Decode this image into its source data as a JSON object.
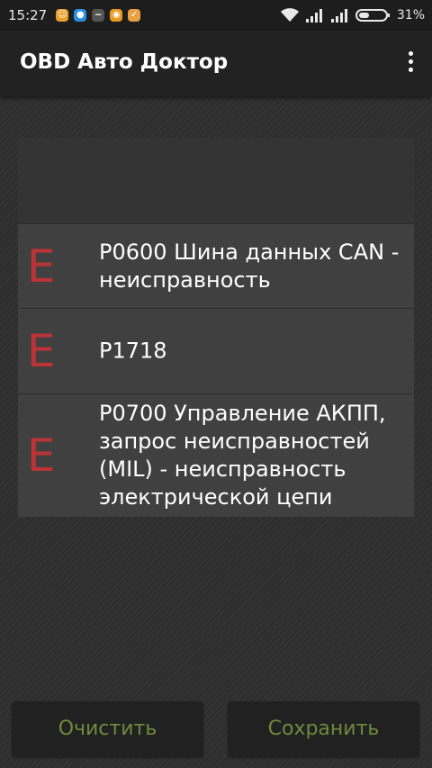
{
  "status_bar": {
    "time": "15:27",
    "notification_icons": [
      "smiley-icon",
      "drop-icon",
      "wave-icon",
      "chat-icon",
      "bell-icon"
    ],
    "battery_percent": "31%"
  },
  "app_bar": {
    "title": "OBD Авто Доктор",
    "menu_icon": "overflow-menu-icon"
  },
  "error_list": [
    {
      "marker": "E",
      "text": "P0600 Шина данных CAN - неисправность"
    },
    {
      "marker": "E",
      "text": "P1718"
    },
    {
      "marker": "E",
      "text": "P0700 Управление АКПП, запрос неисправностей (MIL) - неисправность электрической цепи"
    }
  ],
  "buttons": {
    "clear_label": "Очистить",
    "save_label": "Сохранить"
  },
  "colors": {
    "error_marker": "#b93337",
    "button_text": "#6f8a3c"
  }
}
